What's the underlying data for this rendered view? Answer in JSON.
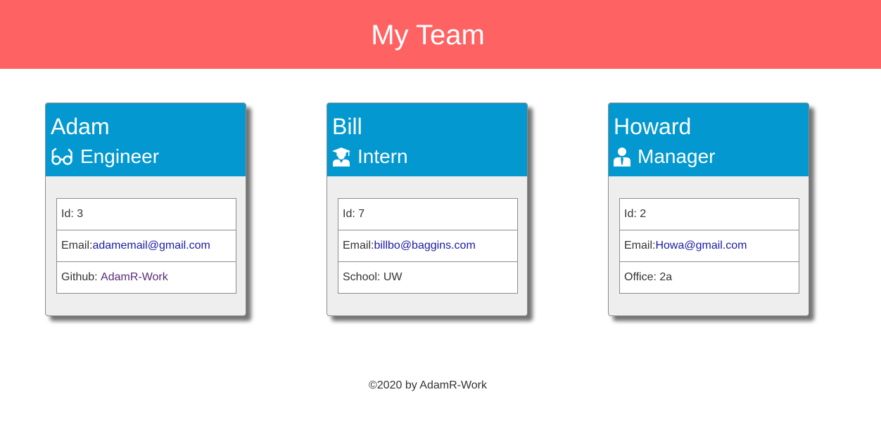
{
  "header": {
    "title": "My Team"
  },
  "colors": {
    "header_bg": "#ff6262",
    "card_header_bg": "#0398d0",
    "card_body_bg": "#efeeef"
  },
  "cards": [
    {
      "name": "Adam",
      "role": "Engineer",
      "icon": "glasses-icon",
      "id_text": "Id: 3",
      "email_label": "Email:",
      "email": "adamemail@gmail.com",
      "extra_label": "Github: ",
      "extra_value": "AdamR-Work"
    },
    {
      "name": "Bill",
      "role": "Intern",
      "icon": "graduate-icon",
      "id_text": "Id: 7",
      "email_label": "Email:",
      "email": "billbo@baggins.com",
      "extra_label": "School: UW",
      "extra_value": ""
    },
    {
      "name": "Howard",
      "role": "Manager",
      "icon": "manager-icon",
      "id_text": "Id: 2",
      "email_label": "Email:",
      "email": "Howa@gmail.com",
      "extra_label": "Office: 2a",
      "extra_value": ""
    }
  ],
  "footer": {
    "text": "©2020 by AdamR-Work"
  }
}
